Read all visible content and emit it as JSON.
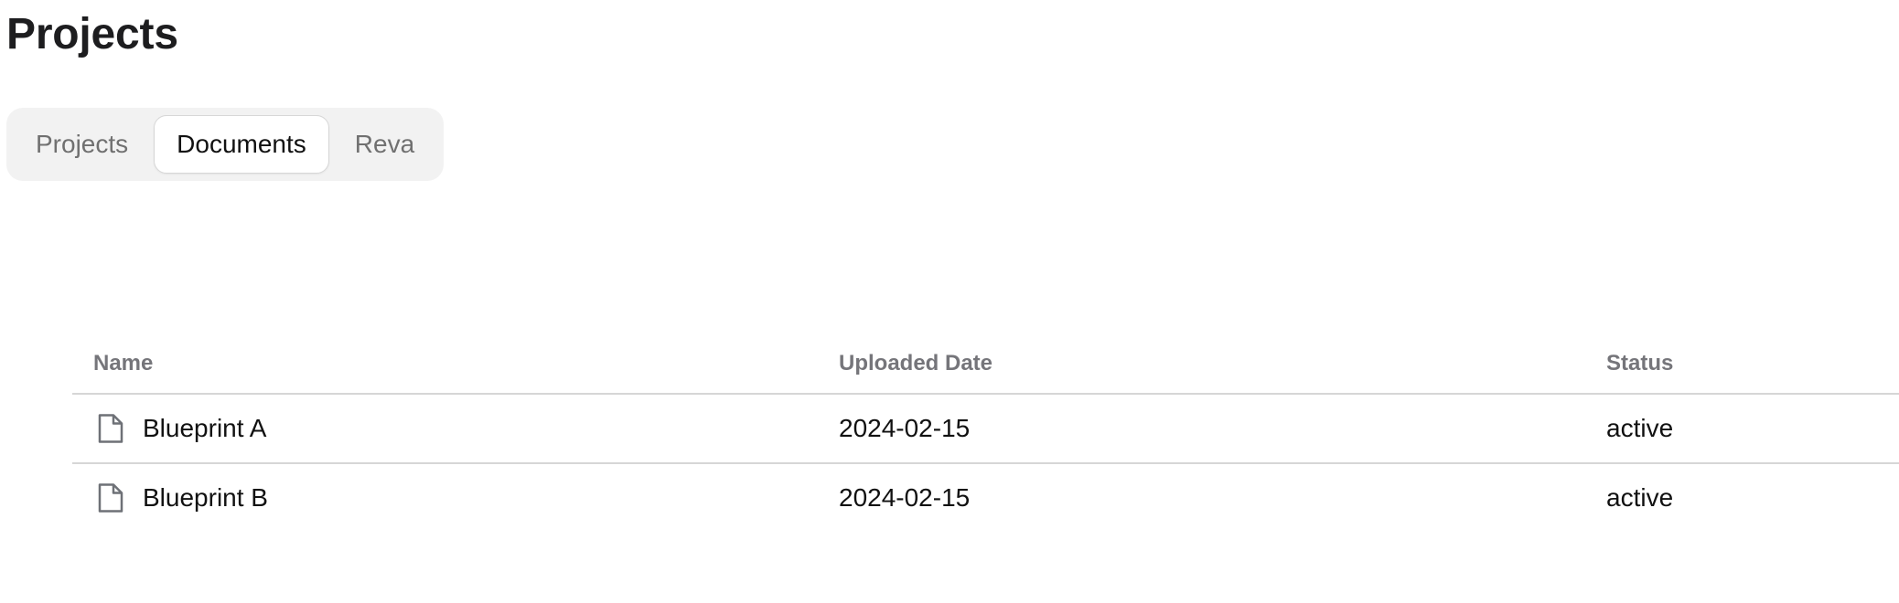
{
  "page": {
    "title": "Projects"
  },
  "tabs": [
    {
      "label": "Projects",
      "active": false
    },
    {
      "label": "Documents",
      "active": true
    },
    {
      "label": "Reva",
      "active": false
    }
  ],
  "table": {
    "columns": {
      "name": "Name",
      "uploaded_date": "Uploaded Date",
      "status": "Status"
    },
    "rows": [
      {
        "icon": "document-icon",
        "name": "Blueprint A",
        "uploaded_date": "2024-02-15",
        "status": "active"
      },
      {
        "icon": "document-icon",
        "name": "Blueprint B",
        "uploaded_date": "2024-02-15",
        "status": "active"
      }
    ]
  },
  "colors": {
    "tabbar_background": "#f2f2f2",
    "active_tab_background": "#ffffff",
    "inactive_tab_text": "#707070",
    "header_text": "#75757a",
    "divider": "#d6d6d6",
    "icon_stroke": "#6e7177"
  }
}
